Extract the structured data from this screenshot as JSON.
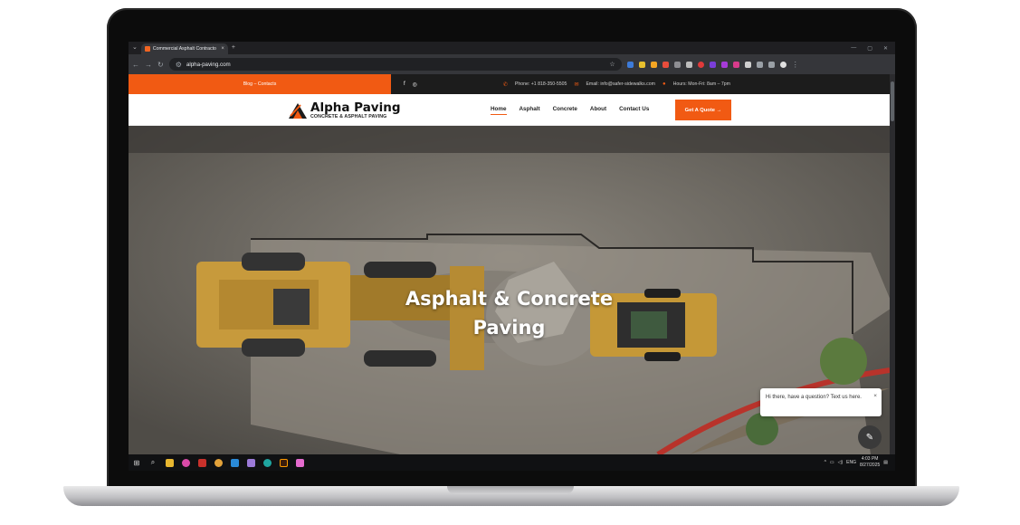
{
  "browser": {
    "tab_title": "Commercial Asphalt Contracto",
    "tab_close": "×",
    "new_tab": "+",
    "url": "alpha-paving.com"
  },
  "site": {
    "topbar": {
      "links": "Blog –  Contacts",
      "phone": "Phone: +1 818-350-5505",
      "email": "Email: info@safer-sidewalks.com",
      "hours": "Hours: Mon-Fri: 8am – 7pm"
    },
    "logo": {
      "name": "Alpha Paving",
      "tagline": "CONCRETE & ASPHALT PAVING"
    },
    "menu": [
      "Home",
      "Asphalt",
      "Concrete",
      "About",
      "Contact Us"
    ],
    "cta": "Get A Quote →",
    "hero": {
      "line1": "Asphalt & Concrete",
      "line2": "Paving"
    },
    "chat": {
      "message": "Hi there, have a question? Text us here.",
      "close": "×"
    }
  },
  "taskbar": {
    "lang": "ENG",
    "time": "4:03 PM",
    "date": "8/27/2025"
  },
  "colors": {
    "accent": "#f15a13",
    "topbar": "#1c1c1c"
  }
}
